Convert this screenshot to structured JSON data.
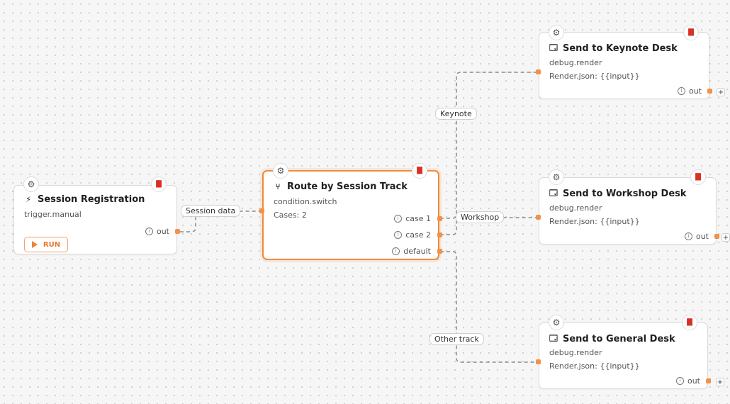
{
  "nodes": {
    "session_registration": {
      "title_icon": "bolt-icon",
      "title": "Session Registration",
      "type": "trigger.manual",
      "run_label": "RUN",
      "output_port": "out"
    },
    "route_by_track": {
      "title_icon": "branch-icon",
      "title": "Route by Session Track",
      "type": "condition.switch",
      "cases_text": "Cases: 2",
      "output_ports": [
        "case 1",
        "case 2",
        "default"
      ]
    },
    "keynote_desk": {
      "title_icon": "window-icon",
      "title": "Send to Keynote Desk",
      "type": "debug.render",
      "config_text": "Render.json: {{input}}",
      "output_port": "out"
    },
    "workshop_desk": {
      "title_icon": "window-icon",
      "title": "Send to Workshop Desk",
      "type": "debug.render",
      "config_text": "Render.json: {{input}}",
      "output_port": "out"
    },
    "general_desk": {
      "title_icon": "window-icon",
      "title": "Send to General Desk",
      "type": "debug.render",
      "config_text": "Render.json: {{input}}",
      "output_port": "out"
    }
  },
  "edges": {
    "session_data": "Session data",
    "keynote": "Keynote",
    "workshop": "Workshop",
    "other_track": "Other track"
  },
  "icons": {
    "settings": "gear-icon",
    "delete": "trash-icon",
    "info": "info-icon",
    "add": "plus-icon",
    "run": "play-icon"
  },
  "colors": {
    "accent": "#f08a3a",
    "delete": "#d93025",
    "canvas": "#f6f6f6",
    "edge": "#8a8a8a"
  }
}
